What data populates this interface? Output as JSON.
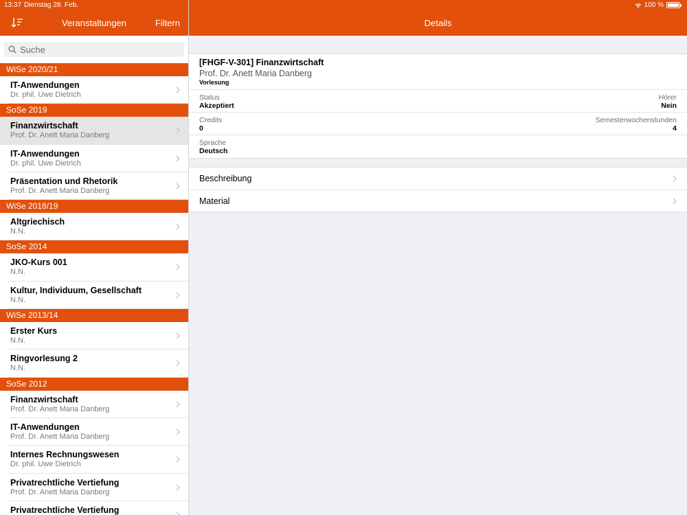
{
  "status_bar": {
    "time": "13:37",
    "date": "Dienstag 28. Feb.",
    "battery": "100 %"
  },
  "master": {
    "title": "Veranstaltungen",
    "filter_label": "Filtern",
    "search_placeholder": "Suche"
  },
  "detail": {
    "title": "Details",
    "course_title": "[FHGF-V-301] Finanzwirtschaft",
    "professor": "Prof. Dr. Anett Maria Danberg",
    "type": "Vorlesung",
    "status_label": "Status",
    "status_value": "Akzeptiert",
    "hoerer_label": "Hörer",
    "hoerer_value": "Nein",
    "credits_label": "Credits",
    "credits_value": "0",
    "sws_label": "Semesterwochenstunden",
    "sws_value": "4",
    "sprache_label": "Sprache",
    "sprache_value": "Deutsch",
    "links": [
      "Beschreibung",
      "Material"
    ]
  },
  "sections": [
    {
      "header": "WiSe 2020/21",
      "items": [
        {
          "title": "IT-Anwendungen",
          "subtitle": "Dr. phil. Uwe Dietrich",
          "selected": false
        }
      ]
    },
    {
      "header": "SoSe 2019",
      "items": [
        {
          "title": "Finanzwirtschaft",
          "subtitle": "Prof. Dr. Anett Maria Danberg",
          "selected": true
        },
        {
          "title": "IT-Anwendungen",
          "subtitle": "Dr. phil. Uwe Dietrich",
          "selected": false
        },
        {
          "title": "Präsentation und Rhetorik",
          "subtitle": "Prof. Dr. Anett Maria Danberg",
          "selected": false
        }
      ]
    },
    {
      "header": "WiSe 2018/19",
      "items": [
        {
          "title": "Altgriechisch",
          "subtitle": "N.N.",
          "selected": false
        }
      ]
    },
    {
      "header": "SoSe 2014",
      "items": [
        {
          "title": "JKO-Kurs 001",
          "subtitle": "N.N.",
          "selected": false
        },
        {
          "title": "Kultur, Individuum, Gesellschaft",
          "subtitle": "N.N.",
          "selected": false
        }
      ]
    },
    {
      "header": "WiSe 2013/14",
      "items": [
        {
          "title": "Erster Kurs",
          "subtitle": "N.N.",
          "selected": false
        },
        {
          "title": "Ringvorlesung 2",
          "subtitle": "N.N.",
          "selected": false
        }
      ]
    },
    {
      "header": "SoSe 2012",
      "items": [
        {
          "title": "Finanzwirtschaft",
          "subtitle": "Prof. Dr. Anett Maria Danberg",
          "selected": false
        },
        {
          "title": "IT-Anwendungen",
          "subtitle": "Prof. Dr. Anett Maria Danberg",
          "selected": false
        },
        {
          "title": "Internes Rechnungswesen",
          "subtitle": "Dr. phil. Uwe Dietrich",
          "selected": false
        },
        {
          "title": "Privatrechtliche Vertiefung",
          "subtitle": "Prof. Dr. Anett Maria Danberg",
          "selected": false
        },
        {
          "title": "Privatrechtliche Vertiefung",
          "subtitle": "",
          "selected": false
        }
      ]
    }
  ]
}
